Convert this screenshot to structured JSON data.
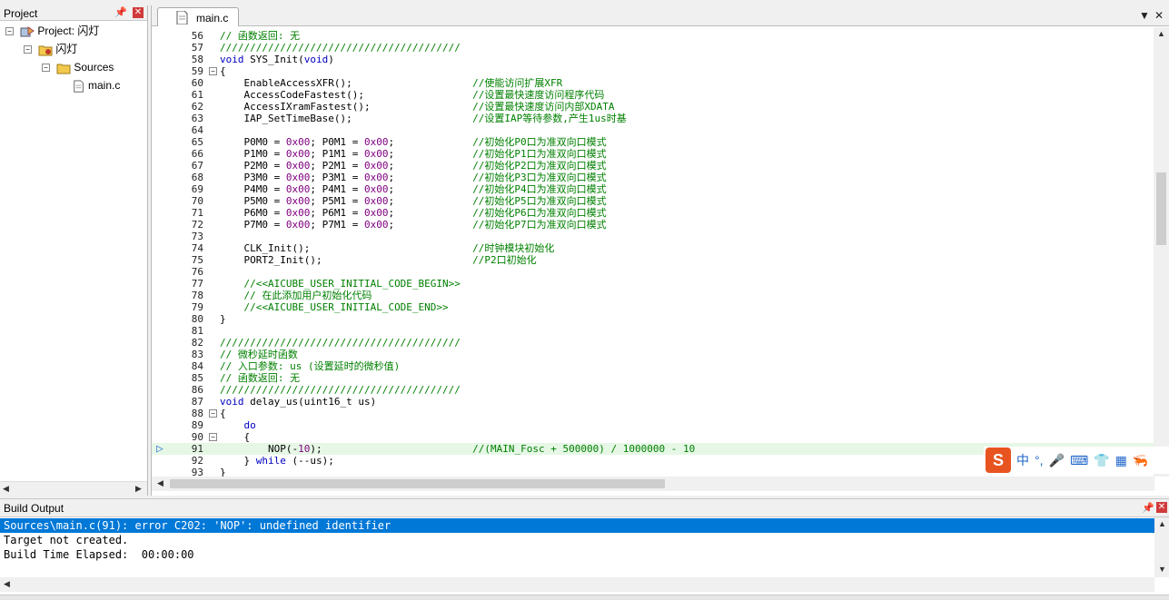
{
  "project_panel": {
    "title": "Project",
    "tree": [
      {
        "label": "Project: 闪灯",
        "level": 0,
        "icon": "project-icon"
      },
      {
        "label": "闪灯",
        "level": 1,
        "icon": "target-folder-icon"
      },
      {
        "label": "Sources",
        "level": 2,
        "icon": "folder-icon"
      },
      {
        "label": "main.c",
        "level": 3,
        "icon": "file-icon"
      }
    ]
  },
  "editor": {
    "active_tab": "main.c",
    "current_line": 91,
    "lines": [
      {
        "n": "56",
        "t": "// 函数返回: 无"
      },
      {
        "n": "57",
        "t": "////////////////////////////////////////"
      },
      {
        "n": "58",
        "t": "void SYS_Init(void)"
      },
      {
        "n": "59",
        "t": "{"
      },
      {
        "n": "60",
        "t": "    EnableAccessXFR();                    //使能访问扩展XFR"
      },
      {
        "n": "61",
        "t": "    AccessCodeFastest();                  //设置最快速度访问程序代码"
      },
      {
        "n": "62",
        "t": "    AccessIXramFastest();                 //设置最快速度访问内部XDATA"
      },
      {
        "n": "63",
        "t": "    IAP_SetTimeBase();                    //设置IAP等待参数,产生1us时基"
      },
      {
        "n": "64",
        "t": ""
      },
      {
        "n": "65",
        "t": "    P0M0 = 0x00; P0M1 = 0x00;             //初始化P0口为准双向口模式"
      },
      {
        "n": "66",
        "t": "    P1M0 = 0x00; P1M1 = 0x00;             //初始化P1口为准双向口模式"
      },
      {
        "n": "67",
        "t": "    P2M0 = 0x00; P2M1 = 0x00;             //初始化P2口为准双向口模式"
      },
      {
        "n": "68",
        "t": "    P3M0 = 0x00; P3M1 = 0x00;             //初始化P3口为准双向口模式"
      },
      {
        "n": "69",
        "t": "    P4M0 = 0x00; P4M1 = 0x00;             //初始化P4口为准双向口模式"
      },
      {
        "n": "70",
        "t": "    P5M0 = 0x00; P5M1 = 0x00;             //初始化P5口为准双向口模式"
      },
      {
        "n": "71",
        "t": "    P6M0 = 0x00; P6M1 = 0x00;             //初始化P6口为准双向口模式"
      },
      {
        "n": "72",
        "t": "    P7M0 = 0x00; P7M1 = 0x00;             //初始化P7口为准双向口模式"
      },
      {
        "n": "73",
        "t": ""
      },
      {
        "n": "74",
        "t": "    CLK_Init();                           //时钟模块初始化"
      },
      {
        "n": "75",
        "t": "    PORT2_Init();                         //P2口初始化"
      },
      {
        "n": "76",
        "t": ""
      },
      {
        "n": "77",
        "t": "    //<<AICUBE_USER_INITIAL_CODE_BEGIN>>"
      },
      {
        "n": "78",
        "t": "    // 在此添加用户初始化代码"
      },
      {
        "n": "79",
        "t": "    //<<AICUBE_USER_INITIAL_CODE_END>>"
      },
      {
        "n": "80",
        "t": "}"
      },
      {
        "n": "81",
        "t": ""
      },
      {
        "n": "82",
        "t": "////////////////////////////////////////"
      },
      {
        "n": "83",
        "t": "// 微秒延时函数"
      },
      {
        "n": "84",
        "t": "// 入口参数: us (设置延时的微秒值)"
      },
      {
        "n": "85",
        "t": "// 函数返回: 无"
      },
      {
        "n": "86",
        "t": "////////////////////////////////////////"
      },
      {
        "n": "87",
        "t": "void delay_us(uint16_t us)"
      },
      {
        "n": "88",
        "t": "{"
      },
      {
        "n": "89",
        "t": "    do"
      },
      {
        "n": "90",
        "t": "    {"
      },
      {
        "n": "91",
        "t": "        NOP(-10);                         //(MAIN_Fosc + 500000) / 1000000 - 10"
      },
      {
        "n": "92",
        "t": "    } while (--us);"
      },
      {
        "n": "93",
        "t": "}"
      }
    ]
  },
  "ime_toolbar": {
    "logo": "S",
    "items": [
      "中",
      "°,",
      "🎤",
      "⌨",
      "👕",
      "▦",
      "🦐"
    ]
  },
  "build_output": {
    "title": "Build Output",
    "lines": [
      "Sources\\main.c(91): error C202: 'NOP': undefined identifier",
      "Target not created.",
      "Build Time Elapsed:  00:00:00"
    ],
    "selected_index": 0
  },
  "colors": {
    "comment": "#008000",
    "keyword": "#0000c0",
    "number": "#800080",
    "selection": "#0078d7",
    "current_line": "#e6f7e6"
  }
}
